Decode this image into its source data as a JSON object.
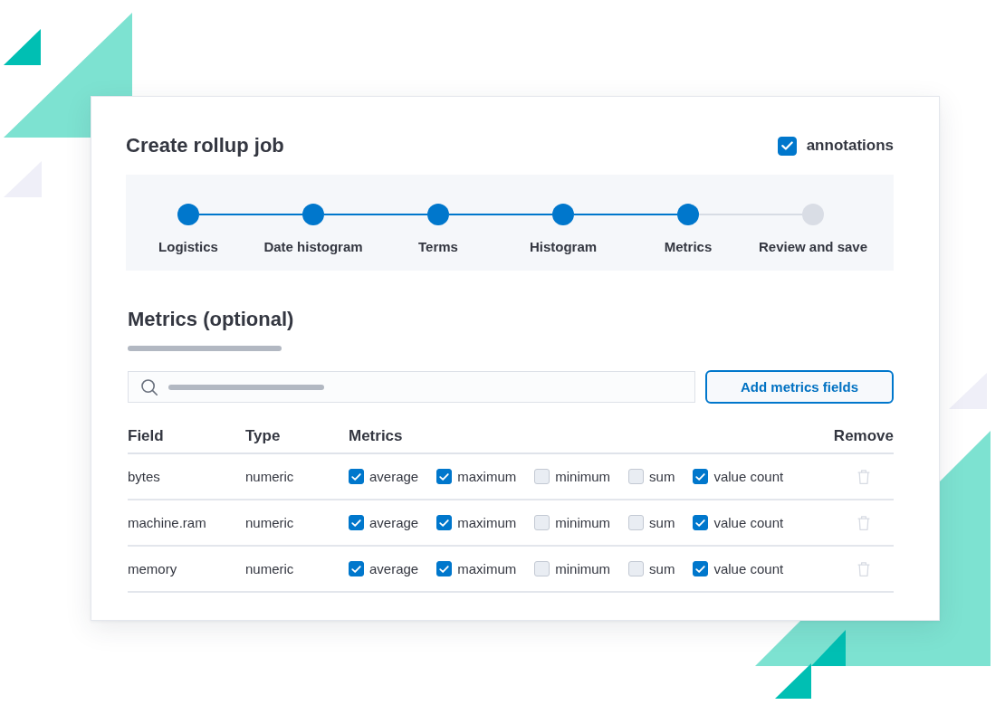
{
  "title": "Create rollup job",
  "annotations": {
    "label": "annotations",
    "checked": true
  },
  "steps": [
    {
      "label": "Logistics",
      "complete": true
    },
    {
      "label": "Date histogram",
      "complete": true
    },
    {
      "label": "Terms",
      "complete": true
    },
    {
      "label": "Histogram",
      "complete": true
    },
    {
      "label": "Metrics",
      "complete": true
    },
    {
      "label": "Review and save",
      "complete": false
    }
  ],
  "section": {
    "title": "Metrics (optional)",
    "add_button": "Add metrics fields"
  },
  "table": {
    "columns": [
      "Field",
      "Type",
      "Metrics",
      "Remove"
    ],
    "rows": [
      {
        "field": "bytes",
        "type": "numeric",
        "metrics": [
          {
            "label": "average",
            "checked": true
          },
          {
            "label": "maximum",
            "checked": true
          },
          {
            "label": "minimum",
            "checked": false
          },
          {
            "label": "sum",
            "checked": false
          },
          {
            "label": "value count",
            "checked": true
          }
        ],
        "remove": {
          "disabled": true
        }
      },
      {
        "field": "machine.ram",
        "type": "numeric",
        "metrics": [
          {
            "label": "average",
            "checked": true
          },
          {
            "label": "maximum",
            "checked": true
          },
          {
            "label": "minimum",
            "checked": false
          },
          {
            "label": "sum",
            "checked": false
          },
          {
            "label": "value count",
            "checked": true
          }
        ],
        "remove": {
          "disabled": true
        }
      },
      {
        "field": "memory",
        "type": "numeric",
        "metrics": [
          {
            "label": "average",
            "checked": true
          },
          {
            "label": "maximum",
            "checked": true
          },
          {
            "label": "minimum",
            "checked": false
          },
          {
            "label": "sum",
            "checked": false
          },
          {
            "label": "value count",
            "checked": true
          }
        ],
        "remove": {
          "disabled": true
        }
      }
    ]
  }
}
